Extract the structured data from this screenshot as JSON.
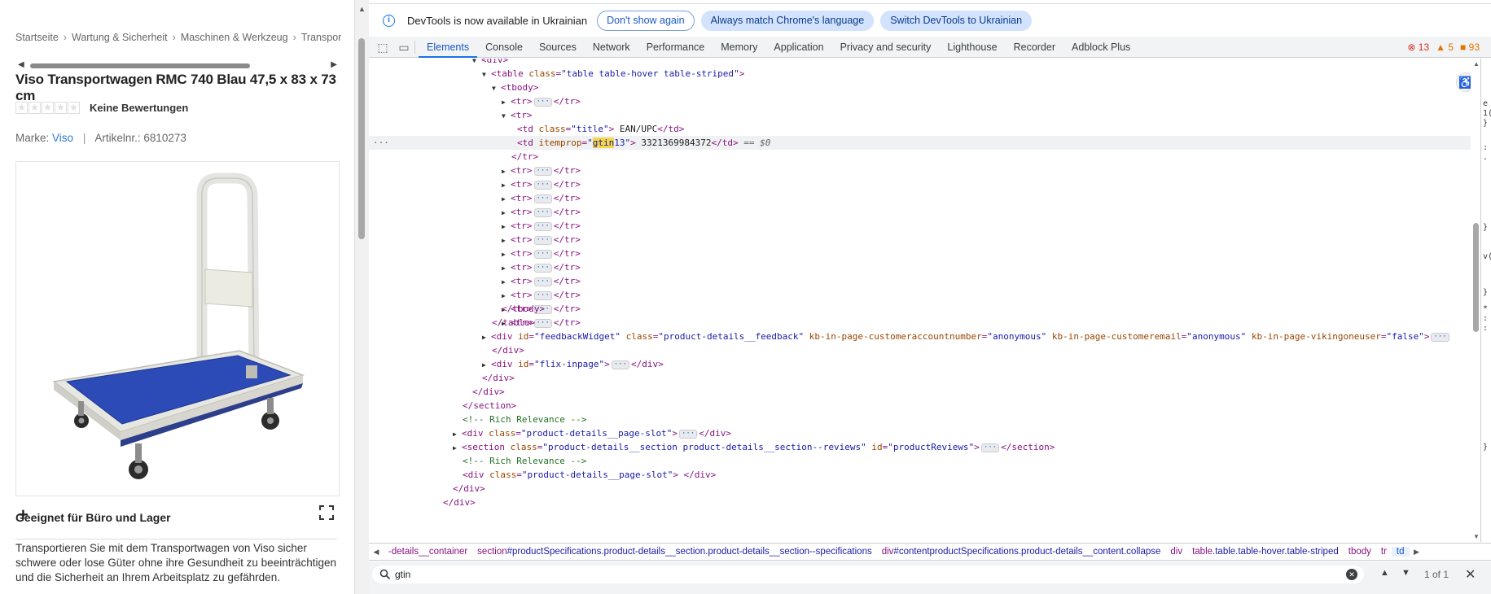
{
  "page": {
    "breadcrumb": [
      "Startseite",
      "Wartung & Sicherheit",
      "Maschinen & Werkzeug",
      "Transport"
    ],
    "title": "Viso Transportwagen RMC 740 Blau 47,5 x 83 x 73 cm",
    "rating_label": "Keine Bewertungen",
    "brand_prefix": "Marke:",
    "brand_name": "Viso",
    "article_label": "Artikelnr.: 6810273",
    "suited_heading": "Geeignet für Büro und Lager",
    "description": "Transportieren Sie mit dem Transportwagen von Viso sicher schwere oder lose Güter ohne ihre Gesundheit zu beeinträchtigen und die Sicherheit an Ihrem Arbeitsplatz zu gefährden.",
    "colors": {
      "link": "#2a7ad2",
      "cart_blue": "#2c4bb6"
    }
  },
  "devtools": {
    "infobar": {
      "message": "DevTools is now available in Ukrainian",
      "btn_dont_show": "Don't show again",
      "btn_match": "Always match Chrome's language",
      "btn_switch": "Switch DevTools to Ukrainian"
    },
    "tabs": [
      "Elements",
      "Console",
      "Sources",
      "Network",
      "Performance",
      "Memory",
      "Application",
      "Privacy and security",
      "Lighthouse",
      "Recorder",
      "Adblock Plus"
    ],
    "badges": {
      "errors": "13",
      "warnings": "5",
      "issues": "93"
    },
    "dom": {
      "div": "div",
      "table": "table",
      "class": "class",
      "table_class": "table table-hover table-striped",
      "tbody": "tbody",
      "tr": "tr",
      "td": "td",
      "title_class": "title",
      "ean_text": " EAN/UPC",
      "itemprop": "itemprop",
      "gtin_hl": "gtin",
      "gtin_rest": "13",
      "gtin_value": " 3321369984372",
      "eq0": "== $0",
      "id": "id",
      "feedback_id": "feedbackWidget",
      "feedback_class": "product-details__feedback",
      "kb_account_attr": "kb-in-page-customeraccountnumber",
      "kb_account_val": "anonymous",
      "kb_email_attr": "kb-in-page-customeremail",
      "kb_email_val": "anonymous",
      "kb_viking_attr": "kb-in-page-vikingoneuser",
      "kb_viking_val": "false",
      "flix_id": "flix-inpage",
      "section": "section",
      "comment_rr": "<!-- Rich Relevance -->",
      "slot_class": "product-details__page-slot",
      "reviews_class": "product-details__section product-details__section--reviews",
      "reviews_id": "productReviews"
    },
    "crumbs": [
      {
        "tag": "-details__container",
        "cls": ""
      },
      {
        "tag": "section",
        "cls": "#productSpecifications.product-details__section.product-details__section--specifications"
      },
      {
        "tag": "div",
        "cls": "#contentproductSpecifications.product-details__content.collapse"
      },
      {
        "tag": "div",
        "cls": ""
      },
      {
        "tag": "table",
        "cls": ".table.table-hover.table-striped"
      },
      {
        "tag": "tbody",
        "cls": ""
      },
      {
        "tag": "tr",
        "cls": ""
      },
      {
        "tag": "td",
        "cls": ""
      }
    ],
    "search": {
      "value": "gtin",
      "count": "1 of 1"
    },
    "styles_strip": [
      "e",
      "1(",
      "}",
      ":",
      ".",
      "}",
      "v(",
      "}",
      "*",
      ":",
      ":",
      "}"
    ]
  }
}
